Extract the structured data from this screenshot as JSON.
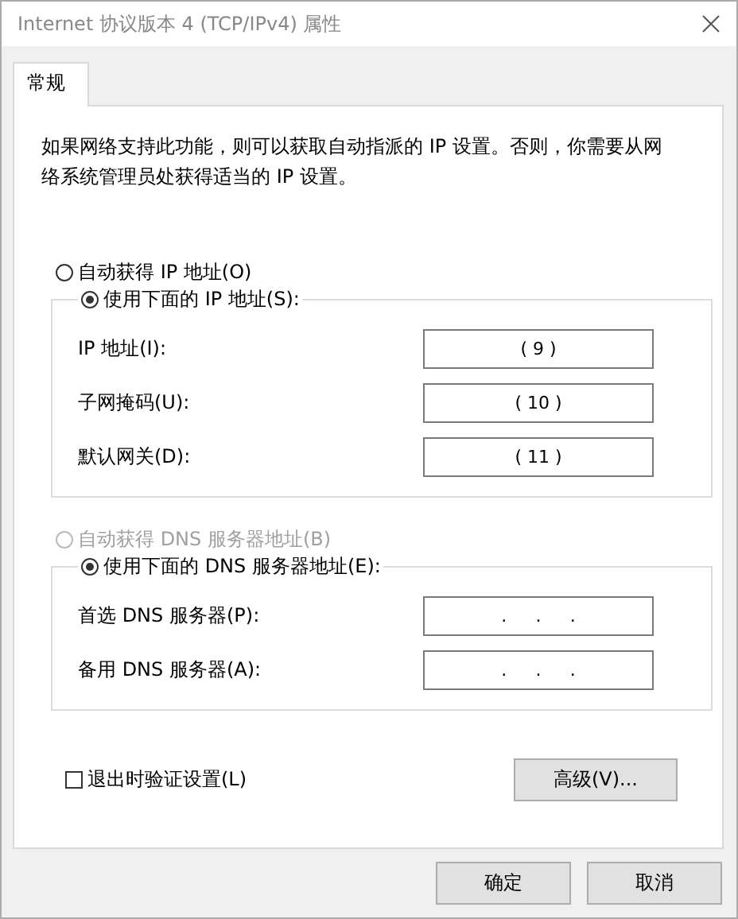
{
  "window": {
    "title": "Internet 协议版本 4 (TCP/IPv4) 属性"
  },
  "tabs": [
    {
      "label": "常规",
      "selected": true
    }
  ],
  "description": "如果网络支持此功能，则可以获取自动指派的 IP 设置。否则，你需要从网络系统管理员处获得适当的 IP 设置。",
  "ip_options": [
    {
      "label": "自动获得 IP 地址(O)",
      "selected": false,
      "disabled": false
    },
    {
      "label": "使用下面的 IP 地址(S):",
      "selected": true,
      "disabled": false,
      "fields": [
        {
          "label": "IP 地址(I):",
          "value": "( 9 )"
        },
        {
          "label": "子网掩码(U):",
          "value": "( 10 )"
        },
        {
          "label": "默认网关(D):",
          "value": "( 11 )"
        }
      ]
    }
  ],
  "dns_options": [
    {
      "label": "自动获得 DNS 服务器地址(B)",
      "selected": false,
      "disabled": true
    },
    {
      "label": "使用下面的 DNS 服务器地址(E):",
      "selected": true,
      "disabled": false,
      "fields": [
        {
          "label": "首选 DNS 服务器(P):",
          "separators": [
            ".",
            ".",
            "."
          ]
        },
        {
          "label": "备用 DNS 服务器(A):",
          "separators": [
            ".",
            ".",
            "."
          ]
        }
      ]
    }
  ],
  "validate_checkbox": {
    "label": "退出时验证设置(L)",
    "checked": false
  },
  "advanced_button": "高级(V)...",
  "buttons": [
    "确定",
    "取消"
  ]
}
